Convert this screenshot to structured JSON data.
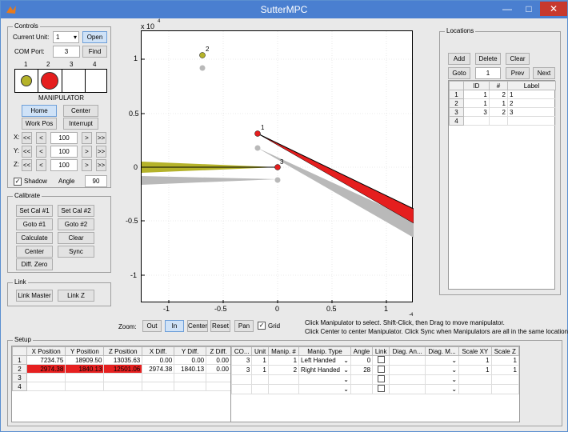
{
  "window": {
    "title": "SutterMPC"
  },
  "controls": {
    "legend": "Controls",
    "current_unit_label": "Current Unit:",
    "current_unit_value": "1",
    "open_label": "Open",
    "com_port_label": "COM Port:",
    "com_port_value": "3",
    "find_label": "Find",
    "slot_numbers": [
      "1",
      "2",
      "3",
      "4"
    ],
    "manipulator_label": "MANIPULATOR",
    "home_label": "Home",
    "center_label": "Center",
    "workpos_label": "Work Pos",
    "interrupt_label": "Interrupt",
    "axes": [
      {
        "label": "X:",
        "value": "100"
      },
      {
        "label": "Y:",
        "value": "100"
      },
      {
        "label": "Z:",
        "value": "100"
      }
    ],
    "step_fast_back": "<<",
    "step_back": "<",
    "step_fwd": ">",
    "step_fast_fwd": ">>",
    "shadow_label": "Shadow",
    "angle_label": "Angle",
    "angle_value": "90",
    "colors": {
      "manip1": "#b5b32a",
      "manip2": "#e51e1e"
    }
  },
  "calibrate": {
    "legend": "Calibrate",
    "setcal1": "Set Cal #1",
    "setcal2": "Set Cal #2",
    "goto1": "Goto #1",
    "goto2": "Goto #2",
    "calculate": "Calculate",
    "clear": "Clear",
    "center": "Center",
    "sync": "Sync",
    "diffzero": "Diff. Zero"
  },
  "link": {
    "legend": "Link",
    "master": "Link Master",
    "linkz": "Link Z"
  },
  "plot": {
    "exponent_label": "x 10",
    "exponent_power": "4",
    "yticks": [
      "1",
      "0.5",
      "0",
      "-0.5",
      "-1"
    ],
    "xticks": [
      "-1",
      "-0.5",
      "0",
      "0.5",
      "1"
    ],
    "markers": [
      {
        "label": "2"
      },
      {
        "label": "1"
      },
      {
        "label": "3"
      }
    ]
  },
  "zoom": {
    "label": "Zoom:",
    "out": "Out",
    "in": "In",
    "center": "Center",
    "reset": "Reset",
    "pan": "Pan",
    "grid": "Grid"
  },
  "help": {
    "line1": "Click Manipulator to select.  Shift-Click, then Drag to move manipulator.",
    "line1_sup": "-4",
    "line2": "Click Center to center Manipulator.  Click Sync when Manipulators are all in the same location."
  },
  "locations": {
    "legend": "Locations",
    "add": "Add",
    "delete": "Delete",
    "clear": "Clear",
    "goto": "Goto",
    "goto_value": "1",
    "prev": "Prev",
    "next": "Next",
    "headers": [
      "ID",
      "#",
      "Label"
    ],
    "rows": [
      {
        "n": "1",
        "id": "1",
        "num": "2",
        "label": "1"
      },
      {
        "n": "2",
        "id": "1",
        "num": "1",
        "label": "2"
      },
      {
        "n": "3",
        "id": "3",
        "num": "2",
        "label": "3"
      },
      {
        "n": "4",
        "id": "",
        "num": "",
        "label": ""
      }
    ]
  },
  "setup": {
    "legend": "Setup",
    "pos_headers": [
      "X Position",
      "Y Position",
      "Z Position",
      "X Diff.",
      "Y Diff.",
      "Z Diff."
    ],
    "pos_rows": [
      {
        "n": "1",
        "cells": [
          "7234.75",
          "18909.50",
          "13035.63",
          "0.00",
          "0.00",
          "0.00"
        ]
      },
      {
        "n": "2",
        "cells": [
          "2974.38",
          "1840.13",
          "12501.06",
          "2974.38",
          "1840.13",
          "0.00"
        ]
      },
      {
        "n": "3",
        "cells": [
          "",
          "",
          "",
          "",
          "",
          ""
        ]
      },
      {
        "n": "4",
        "cells": [
          "",
          "",
          "",
          "",
          "",
          ""
        ]
      }
    ],
    "man_headers": [
      "CO...",
      "Unit",
      "Manip. #",
      "Manip. Type",
      "Angle",
      "Link",
      "Diag. An...",
      "Diag. M...",
      "Scale XY",
      "Scale Z"
    ],
    "man_rows": [
      {
        "co": "3",
        "unit": "1",
        "manip": "1",
        "type": "Left Handed",
        "angle": "0",
        "sxy": "1",
        "sz": "1"
      },
      {
        "co": "3",
        "unit": "1",
        "manip": "2",
        "type": "Right Handed",
        "angle": "28",
        "sxy": "1",
        "sz": "1"
      },
      {
        "co": "",
        "unit": "",
        "manip": "",
        "type": "",
        "angle": "",
        "sxy": "",
        "sz": ""
      },
      {
        "co": "",
        "unit": "",
        "manip": "",
        "type": "",
        "angle": "",
        "sxy": "",
        "sz": ""
      }
    ]
  }
}
